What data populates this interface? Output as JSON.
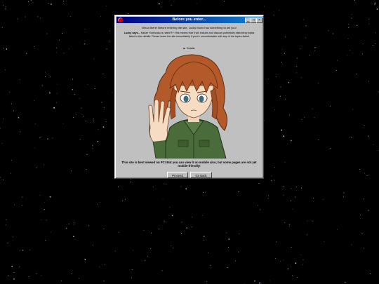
{
  "window": {
    "title": "Before you enter...",
    "controls": {
      "minimize": "_",
      "maximize": "□",
      "close": "×"
    }
  },
  "intro": "Whoa there! Before entering the site, Lucky Morin has something to tell you!",
  "warning": {
    "lead": "Lucky says...",
    "body": "Kaiser Yoshizaku is rated R+: this means that it will include and discuss potentially disturbing topics listed in the details. Please leave the site immediately if you're uncomfortable with any of the topics listed!"
  },
  "details_label": "Details",
  "notice": "This site is best viewed on PC! But you can view it on mobile also, but some pages are not yet mobile-friendly!",
  "buttons": {
    "proceed": "Proceed",
    "go_back": "Go Back"
  },
  "colors": {
    "titlebar_start": "#000080",
    "titlebar_end": "#1084d0",
    "window": "#c0c0c0",
    "desktop": "#000000"
  }
}
